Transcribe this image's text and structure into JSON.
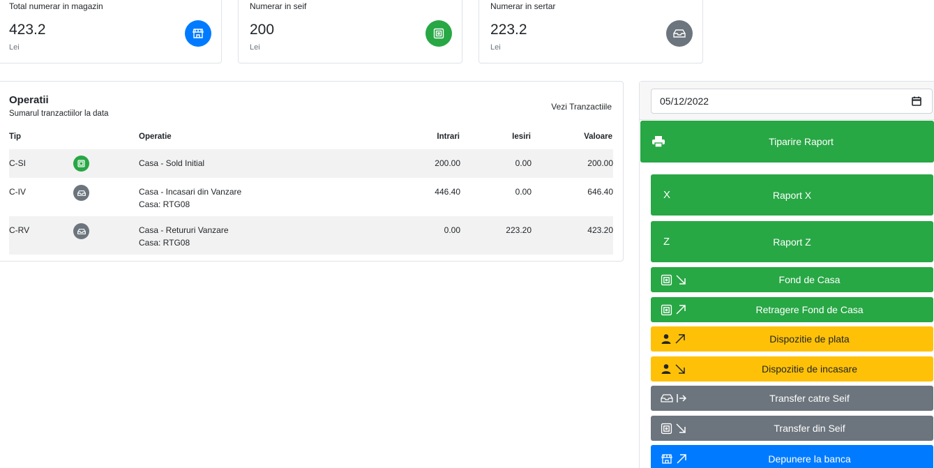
{
  "colors": {
    "primary": "#007bff",
    "success": "#28a745",
    "secondary": "#6c757d",
    "warning": "#ffc107"
  },
  "cards": [
    {
      "label": "Total numerar in magazin",
      "value": "423.2",
      "unit": "Lei",
      "icon": "store-icon",
      "color": "#007bff"
    },
    {
      "label": "Numerar in seif",
      "value": "200",
      "unit": "Lei",
      "icon": "safe-icon",
      "color": "#28a745"
    },
    {
      "label": "Numerar in sertar",
      "value": "223.2",
      "unit": "Lei",
      "icon": "drawer-icon",
      "color": "#6c757d"
    }
  ],
  "operations": {
    "title": "Operatii",
    "subtitle": "Sumarul tranzactiilor la data",
    "link": "Vezi Tranzactiile",
    "columns": {
      "tip": "Tip",
      "operatie": "Operatie",
      "intrari": "Intrari",
      "iesiri": "Iesiri",
      "valoare": "Valoare"
    },
    "rows": [
      {
        "tip": "C-SI",
        "icon": "safe-icon",
        "color": "#28a745",
        "operatie": "Casa - Sold Initial",
        "detail": "",
        "intrari": "200.00",
        "iesiri": "0.00",
        "valoare": "200.00"
      },
      {
        "tip": "C-IV",
        "icon": "drawer-icon",
        "color": "#6c757d",
        "operatie": "Casa - Incasari din Vanzare",
        "detail": "Casa: RTG08",
        "intrari": "446.40",
        "iesiri": "0.00",
        "valoare": "646.40"
      },
      {
        "tip": "C-RV",
        "icon": "drawer-icon",
        "color": "#6c757d",
        "operatie": "Casa - Retururi Vanzare",
        "detail": "Casa: RTG08",
        "intrari": "0.00",
        "iesiri": "223.20",
        "valoare": "423.20"
      }
    ]
  },
  "side": {
    "date_value": "05/12/2022",
    "print_label": "Tiparire Raport",
    "buttons": [
      {
        "label": "Raport X",
        "lead": "X"
      },
      {
        "label": "Raport Z",
        "lead": "Z"
      },
      {
        "label": "Fond de Casa",
        "icons": [
          "safe-icon",
          "arrow-down-right-icon"
        ]
      },
      {
        "label": "Retragere Fond de Casa",
        "icons": [
          "safe-icon",
          "arrow-up-right-icon"
        ]
      },
      {
        "label": "Dispozitie de plata",
        "icons": [
          "person-icon",
          "arrow-up-right-icon"
        ]
      },
      {
        "label": "Dispozitie de incasare",
        "icons": [
          "person-icon",
          "arrow-down-right-icon"
        ]
      },
      {
        "label": "Transfer catre Seif",
        "icons": [
          "drawer-icon",
          "transfer-right-icon"
        ]
      },
      {
        "label": "Transfer din Seif",
        "icons": [
          "safe-icon",
          "arrow-down-right-icon"
        ]
      },
      {
        "label": "Depunere la banca",
        "icons": [
          "store-icon",
          "arrow-up-right-icon"
        ]
      }
    ]
  }
}
